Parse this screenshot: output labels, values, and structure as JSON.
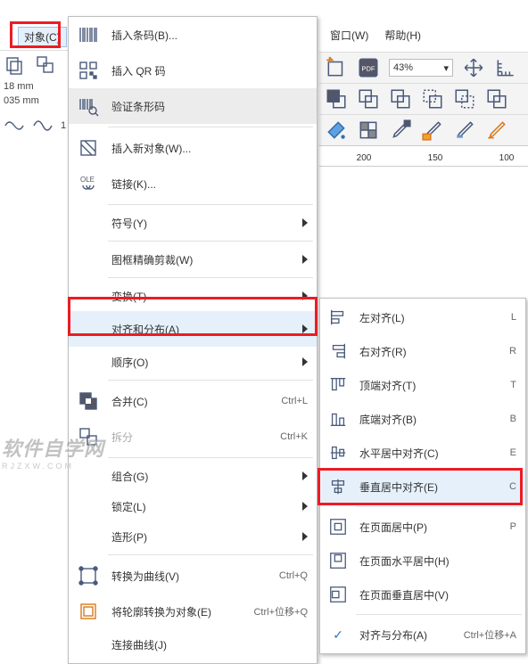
{
  "top_menu": {
    "object": "对象(C)"
  },
  "right_menu": {
    "window": "窗口(W)",
    "help": "帮助(H)"
  },
  "dims": {
    "w": "18 mm",
    "h": "035 mm",
    "aux": "1"
  },
  "zoom": "43%",
  "ruler": {
    "t200": "200",
    "t150": "150",
    "t100": "100"
  },
  "watermark": "软件自学网",
  "watermark_url": "RJZXW.COM",
  "menu": {
    "insert_barcode": "插入条码(B)...",
    "insert_qr": "插入 QR 码",
    "verify_barcode": "验证条形码",
    "insert_new_obj": "插入新对象(W)...",
    "links": "链接(K)...",
    "symbol": "符号(Y)",
    "powerclip": "图框精确剪裁(W)",
    "transform": "变换(T)",
    "align_dist": "对齐和分布(A)",
    "order": "顺序(O)",
    "combine": "合并(C)",
    "combine_sc": "Ctrl+L",
    "break": "拆分",
    "break_sc": "Ctrl+K",
    "group": "组合(G)",
    "lock": "锁定(L)",
    "shaping": "造形(P)",
    "to_curves": "转换为曲线(V)",
    "to_curves_sc": "Ctrl+Q",
    "outline_to_obj": "将轮廓转换为对象(E)",
    "outline_sc": "Ctrl+位移+Q",
    "connect_curve": "连接曲线(J)"
  },
  "sub": {
    "left": "左对齐(L)",
    "left_sc": "L",
    "right": "右对齐(R)",
    "right_sc": "R",
    "top": "顶端对齐(T)",
    "top_sc": "T",
    "bottom": "底端对齐(B)",
    "bottom_sc": "B",
    "hcenter": "水平居中对齐(C)",
    "hcenter_sc": "E",
    "vcenter": "垂直居中对齐(E)",
    "vcenter_sc": "C",
    "page_center": "在页面居中(P)",
    "page_center_sc": "P",
    "page_h": "在页面水平居中(H)",
    "page_v": "在页面垂直居中(V)",
    "dialog": "对齐与分布(A)",
    "dialog_sc": "Ctrl+位移+A"
  }
}
